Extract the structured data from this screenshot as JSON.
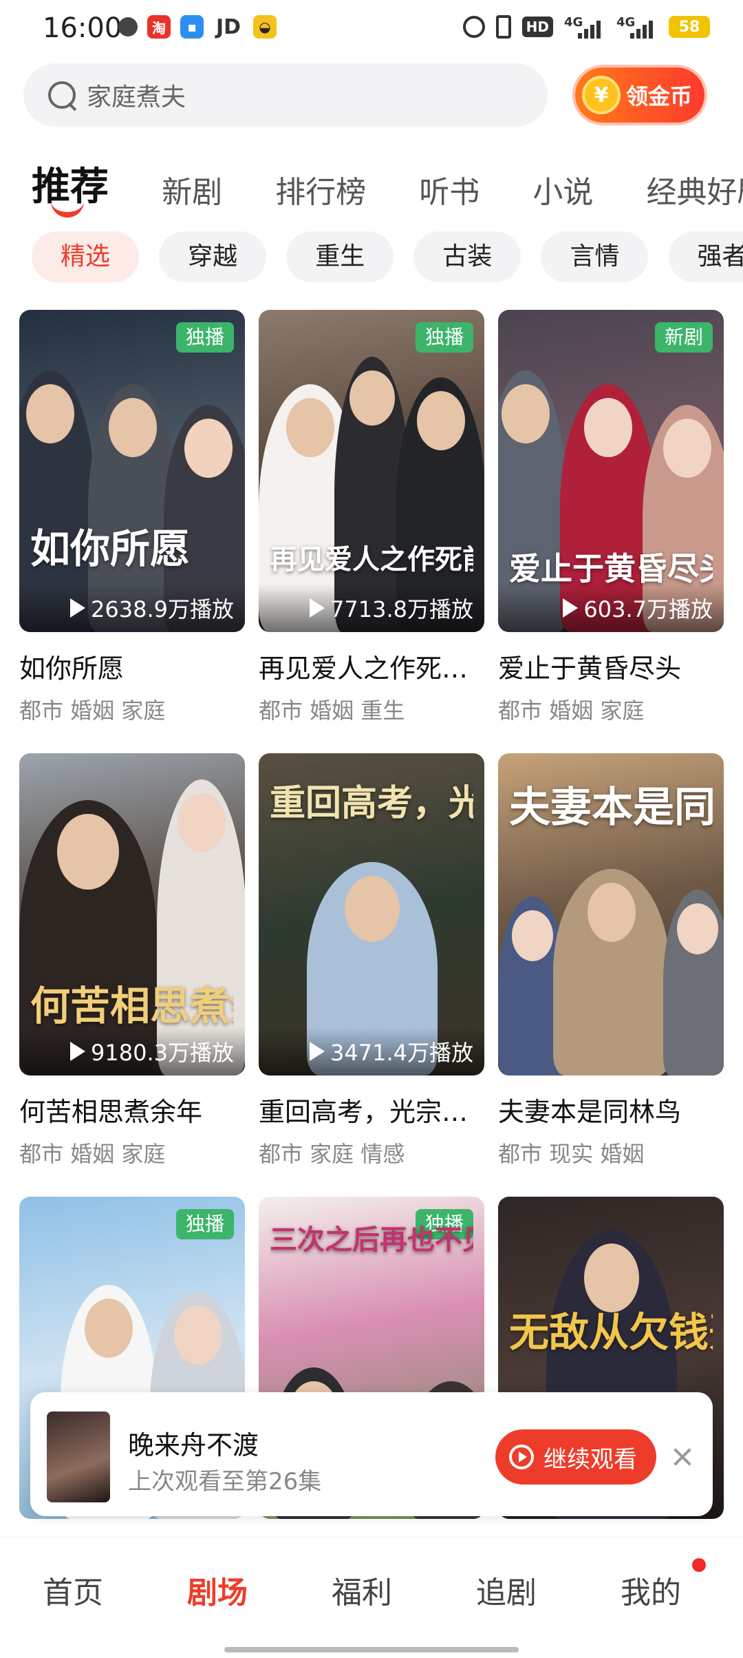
{
  "status_bar": {
    "time": "16:00",
    "app_icons": [
      "globe-icon",
      "shopping-icon",
      "message-icon",
      "jd-icon",
      "app-icon"
    ],
    "jd_label": "JD",
    "hd_label": "HD",
    "signal_1": "4G",
    "signal_2": "4G",
    "battery": "58"
  },
  "search": {
    "placeholder": "家庭煮夫"
  },
  "coin_button": {
    "icon": "¥",
    "label": "领金币"
  },
  "main_tabs": [
    "推荐",
    "新剧",
    "排行榜",
    "听书",
    "小说",
    "经典好剧"
  ],
  "chips": [
    "精选",
    "穿越",
    "重生",
    "古装",
    "言情",
    "强者"
  ],
  "cards": [
    {
      "title": "如你所愿",
      "tags": "都市 婚姻 家庭",
      "badge": "独播",
      "plays": "2638.9万播放",
      "poster_text": "如你所愿"
    },
    {
      "title": "再见爱人之作死…",
      "tags": "都市 婚姻 重生",
      "badge": "独播",
      "plays": "7713.8万播放",
      "poster_text": "再见爱人之作死前妻后悔了"
    },
    {
      "title": "爱止于黄昏尽头",
      "tags": "都市 婚姻 家庭",
      "badge": "新剧",
      "plays": "603.7万播放",
      "poster_text": "爱止于黄昏尽头"
    },
    {
      "title": "何苦相思煮余年",
      "tags": "都市 婚姻 家庭",
      "badge": "",
      "plays": "9180.3万播放",
      "poster_text": "何苦相思煮余年"
    },
    {
      "title": "重回高考，光宗…",
      "tags": "都市 家庭 情感",
      "badge": "",
      "plays": "3471.4万播放",
      "poster_text": "重回高考，光宗耀祖"
    },
    {
      "title": "夫妻本是同林鸟",
      "tags": "都市 现实 婚姻",
      "badge": "",
      "plays": "",
      "poster_text": "夫妻本是同林鸟"
    },
    {
      "title": "",
      "tags": "",
      "badge": "独播",
      "plays": "",
      "poster_text": ""
    },
    {
      "title": "",
      "tags": "",
      "badge": "独播",
      "plays": "",
      "poster_text": "三次之后再也不见"
    },
    {
      "title": "",
      "tags": "",
      "badge": "",
      "plays": "",
      "poster_text": "无敌从欠钱开始"
    }
  ],
  "continue_watching": {
    "title": "晚来舟不渡",
    "subtitle": "上次观看至第26集",
    "button_label": "继续观看"
  },
  "bottom_nav": [
    "首页",
    "剧场",
    "福利",
    "追剧",
    "我的"
  ],
  "colors": {
    "accent": "#ee3c2a",
    "badge_green": "#3cb46a"
  }
}
